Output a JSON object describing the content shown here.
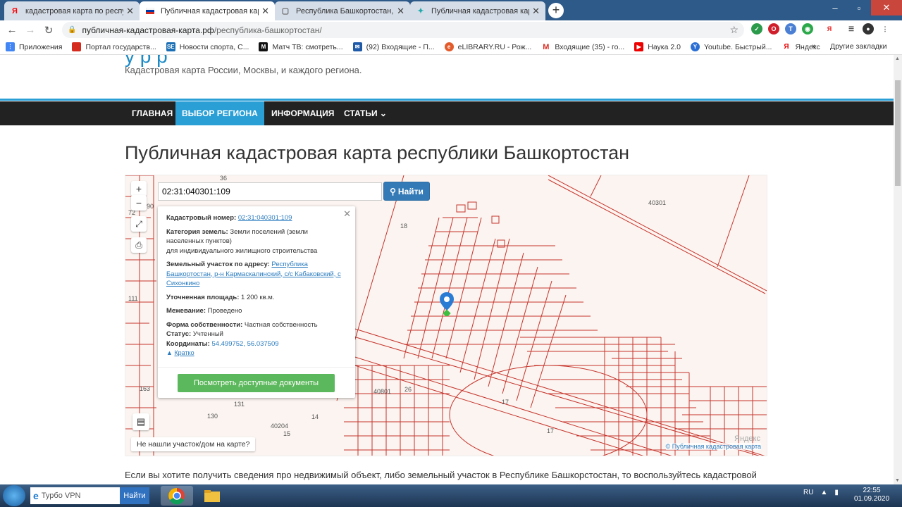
{
  "browser": {
    "tabs": [
      {
        "title": "кадастровая карта по республ",
        "icon": "yandex-icon",
        "active": false
      },
      {
        "title": "Публичная кадастровая карта р",
        "icon": "ru-flag-icon",
        "active": true
      },
      {
        "title": "Республика Башкортостан, р-н",
        "icon": "document-icon",
        "active": false
      },
      {
        "title": "Публичная кадастровая карта",
        "icon": "map-icon",
        "active": false
      }
    ],
    "url": {
      "host": "публичная-кадастровая-карта.рф",
      "path": "/республика-башкортостан/"
    },
    "bookmarks": [
      "Приложения",
      "Портал государств...",
      "Новости спорта, С...",
      "Матч ТВ: смотреть...",
      "(92) Входящие - П...",
      "eLIBRARY.RU - Рож...",
      "Входящие (35) - го...",
      "Наука 2.0",
      "Youtube. Быстрый...",
      "Яндекс"
    ],
    "bookmarks_more": "»",
    "bookmarks_other": "Другие закладки"
  },
  "site": {
    "tagline": "Кадастровая карта России, Москвы, и каждого региона.",
    "nav": [
      "ГЛАВНАЯ",
      "ВЫБОР РЕГИОНА ⌄",
      "ИНФОРМАЦИЯ",
      "СТАТЬИ ⌄"
    ],
    "page_title": "Публичная кадастровая карта республики Башкортостан"
  },
  "map": {
    "search_value": "02:31:040301:109",
    "search_button": "Найти",
    "zoom_in": "+",
    "zoom_out": "−",
    "popup": {
      "cadastral_label": "Кадастровый номер:",
      "cadastral_value": "02:31:040301:109",
      "category_label": "Категория земель:",
      "category_value": "Земли поселений (земли населенных пунктов)",
      "category_use": "для индивидуального жилищного строительства",
      "address_label": "Земельный участок по адресу:",
      "address_value": "Республика Башкортостан, р-н Кармаскалинский, с/с Кабаковский, с Сихонкино",
      "area_label": "Уточненная площадь:",
      "area_value": "1 200 кв.м.",
      "survey_label": "Межевание:",
      "survey_value": "Проведено",
      "ownership_label": "Форма собственности:",
      "ownership_value": "Частная собственность",
      "status_label": "Статус:",
      "status_value": "Учтенный",
      "coords_label": "Координаты:",
      "coords_value": "54.499752, 56.037509",
      "brief_link": "Кратко",
      "docs_button": "Посмотреть доступные документы"
    },
    "not_found": "Не нашли участок/дом на карте?",
    "credit": "© Публичная кадастровая карта",
    "watermark": "Яндекс",
    "labels": [
      "40301",
      "18",
      "40801",
      "26",
      "17",
      "17",
      "40204",
      "14",
      "15",
      "131",
      "130",
      "111",
      "163",
      "36",
      "72",
      "90"
    ]
  },
  "body_text": "Если вы хотите получить сведения про недвижимый объект, либо земельный участок в Республике Башкорстостан, то воспользуйтесь кадастровой",
  "taskbar": {
    "search_text": "Турбо VPN",
    "search_button": "Найти",
    "lang": "RU",
    "time": "22:55",
    "date": "01.09.2020"
  },
  "colors": {
    "accent": "#2a9fd6",
    "nav_bg": "#222222",
    "green_button": "#5cb85c",
    "search_button": "#337ab7"
  }
}
